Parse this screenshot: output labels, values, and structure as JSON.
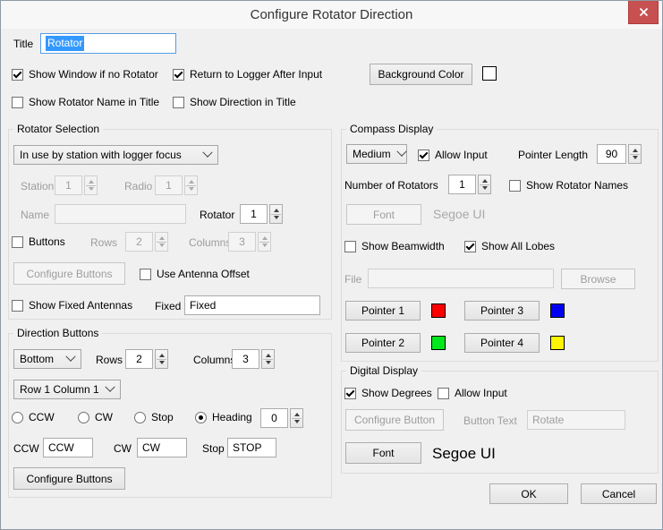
{
  "window": {
    "title": "Configure Rotator Direction"
  },
  "header": {
    "title_label": "Title",
    "title_value": "Rotator",
    "cb_show_window": "Show Window if no Rotator",
    "cb_return_logger": "Return to Logger After Input",
    "background_color_button": "Background Color",
    "background_color_value": "#ffffff",
    "cb_show_rotator_name": "Show Rotator Name in Title",
    "cb_show_direction": "Show Direction in Title"
  },
  "rotator_selection": {
    "group_title": "Rotator Selection",
    "mode_dropdown_value": "In use by station with logger focus",
    "station_label": "Station",
    "station_value": "1",
    "radio_label": "Radio",
    "radio_value": "1",
    "name_label": "Name",
    "name_value": "",
    "rotator_label": "Rotator",
    "rotator_value": "1",
    "buttons_checkbox": "Buttons",
    "rows_label": "Rows",
    "rows_value": "2",
    "columns_label": "Columns",
    "columns_value": "3",
    "configure_buttons_button": "Configure Buttons",
    "use_antenna_offset_checkbox": "Use Antenna Offset",
    "show_fixed_antennas_checkbox": "Show Fixed Antennas",
    "fixed_label": "Fixed",
    "fixed_value": "Fixed"
  },
  "direction_buttons": {
    "group_title": "Direction Buttons",
    "position_dropdown_value": "Bottom",
    "rows_label": "Rows",
    "rows_value": "2",
    "columns_label": "Columns",
    "columns_value": "3",
    "cell_dropdown_value": "Row 1 Column 1",
    "radio_ccw": "CCW",
    "radio_cw": "CW",
    "radio_stop": "Stop",
    "radio_heading": "Heading",
    "heading_value": "0",
    "ccw_label": "CCW",
    "ccw_value": "CCW",
    "cw_label": "CW",
    "cw_value": "CW",
    "stop_label": "Stop",
    "stop_value": "STOP",
    "configure_buttons_button": "Configure Buttons"
  },
  "compass_display": {
    "group_title": "Compass Display",
    "size_dropdown_value": "Medium",
    "allow_input_checkbox": "Allow Input",
    "pointer_length_label": "Pointer Length",
    "pointer_length_value": "90",
    "number_of_rotators_label": "Number of Rotators",
    "number_of_rotators_value": "1",
    "show_rotator_names_checkbox": "Show Rotator Names",
    "font_button": "Font",
    "font_name": "Segoe UI",
    "show_beamwidth_checkbox": "Show Beamwidth",
    "show_all_lobes_checkbox": "Show All Lobes",
    "file_label": "File",
    "file_value": "",
    "browse_button": "Browse",
    "pointer1_button": "Pointer 1",
    "pointer2_button": "Pointer 2",
    "pointer3_button": "Pointer 3",
    "pointer4_button": "Pointer 4",
    "pointer1_color": "#fe0000",
    "pointer2_color": "#00e81b",
    "pointer3_color": "#0000f0",
    "pointer4_color": "#fff500"
  },
  "digital_display": {
    "group_title": "Digital Display",
    "show_degrees_checkbox": "Show Degrees",
    "allow_input_checkbox": "Allow Input",
    "configure_button_button": "Configure Button",
    "button_text_label": "Button Text",
    "button_text_value": "Rotate",
    "font_button": "Font",
    "font_name": "Segoe UI"
  },
  "footer": {
    "ok_button": "OK",
    "cancel_button": "Cancel"
  }
}
